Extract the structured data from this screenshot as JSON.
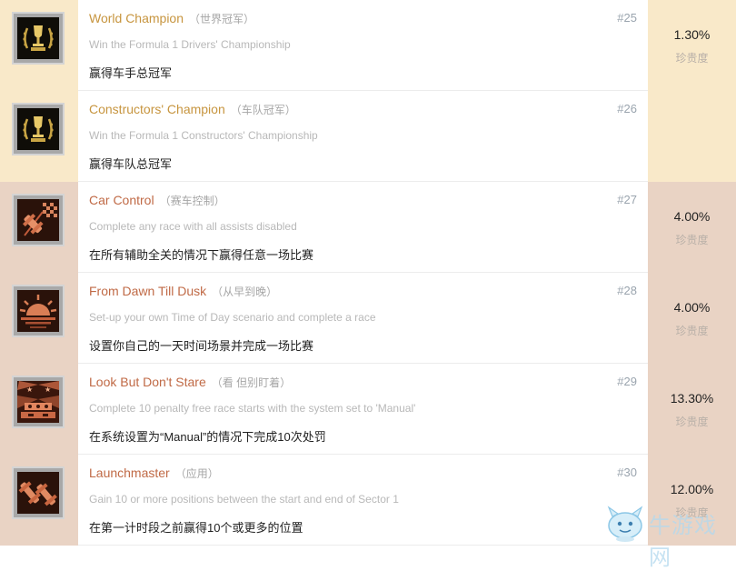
{
  "achievements": [
    {
      "title": "World Champion",
      "cn_title": "（世界冠军）",
      "num": "#25",
      "desc_en": "Win the Formula 1 Drivers' Championship",
      "desc_cn": "赢得车手总冠军",
      "percent": "1.30%",
      "rarity_label": "珍贵度",
      "tier": "gold",
      "icon": "trophy-wreath-icon"
    },
    {
      "title": "Constructors' Champion",
      "cn_title": "（车队冠军）",
      "num": "#26",
      "desc_en": "Win the Formula 1 Constructors' Championship",
      "desc_cn": "赢得车队总冠军",
      "percent": "",
      "rarity_label": "",
      "tier": "gold",
      "icon": "trophy-wreath-icon"
    },
    {
      "title": "Car Control",
      "cn_title": "（赛车控制）",
      "num": "#27",
      "desc_en": "Complete any race with all assists disabled",
      "desc_cn": "在所有辅助全关的情况下赢得任意一场比赛",
      "percent": "4.00%",
      "rarity_label": "珍贵度",
      "tier": "bronze",
      "icon": "car-checkered-flag-icon"
    },
    {
      "title": "From Dawn Till Dusk",
      "cn_title": "（从早到晚）",
      "num": "#28",
      "desc_en": "Set-up your own Time of Day scenario and complete a race",
      "desc_cn": "设置你自己的一天时间场景并完成一场比赛",
      "percent": "4.00%",
      "rarity_label": "珍贵度",
      "tier": "bronze",
      "icon": "sunset-icon"
    },
    {
      "title": "Look But Don't Stare",
      "cn_title": "（看 但别盯着）",
      "num": "#29",
      "desc_en": "Complete 10 penalty free race starts with the system set to 'Manual'",
      "desc_cn": "在系统设置为“Manual”的情况下完成10次处罚",
      "percent": "13.30%",
      "rarity_label": "珍贵度",
      "tier": "bronze",
      "icon": "start-lights-icon"
    },
    {
      "title": "Launchmaster",
      "cn_title": "（应用）",
      "num": "#30",
      "desc_en": "Gain 10 or more positions between the start and end of Sector 1",
      "desc_cn": "在第一计时段之前赢得10个或更多的位置",
      "percent": "12.00%",
      "rarity_label": "珍贵度",
      "tier": "bronze",
      "icon": "race-cars-icon"
    }
  ],
  "watermark": {
    "text": "牛游戏网",
    "icon": "mascot-icon"
  }
}
